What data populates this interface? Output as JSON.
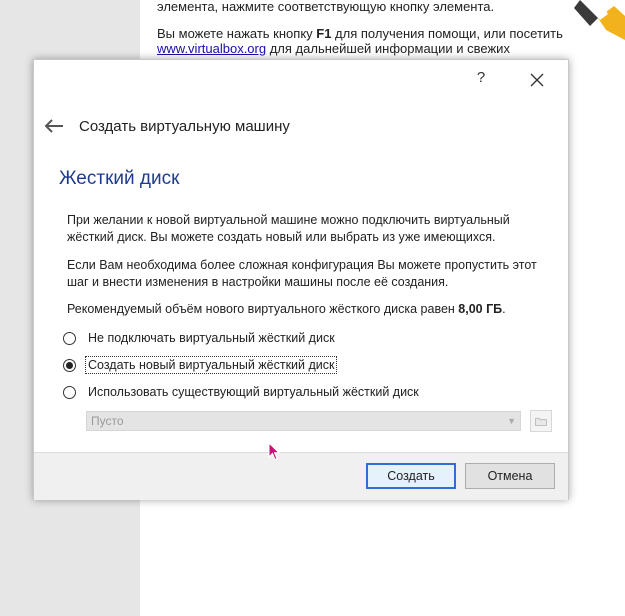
{
  "background": {
    "line1": "элемента, нажмите соответствующую кнопку элемента.",
    "line2_pre": "Вы можете нажать кнопку ",
    "line2_key": "F1",
    "line2_post": " для получения помощи, или посетить",
    "link": "www.virtualbox.org",
    "line3_post": " для дальнейшей информации и свежих"
  },
  "dialog": {
    "help_label": "?",
    "wizard_title": "Создать виртуальную машину",
    "page_title": "Жесткий диск",
    "para1": "При желании к новой виртуальной машине можно подключить виртуальный жёсткий диск. Вы можете создать новый или выбрать из уже имеющихся.",
    "para2": "Если Вам необходима более сложная конфигурация Вы можете пропустить этот шаг и внести изменения в настройки машины после её создания.",
    "recommend_text": "Рекомендуемый объём нового виртуального жёсткого диска равен ",
    "recommend_size": "8,00 ГБ",
    "recommend_end": ".",
    "options": [
      {
        "label": "Не подключать виртуальный жёсткий диск",
        "checked": false
      },
      {
        "label": "Создать новый виртуальный жёсткий диск",
        "checked": true
      },
      {
        "label": "Использовать существующий виртуальный жёсткий диск",
        "checked": false
      }
    ],
    "combo_value": "Пусто",
    "create_label": "Создать",
    "cancel_label": "Отмена"
  },
  "icons": [
    "close-icon",
    "back-arrow-icon",
    "folder-icon",
    "chevron-down-icon",
    "mouse-cursor-icon"
  ],
  "colors": {
    "accent": "#2f6fd1",
    "title": "#1f3c8c"
  }
}
